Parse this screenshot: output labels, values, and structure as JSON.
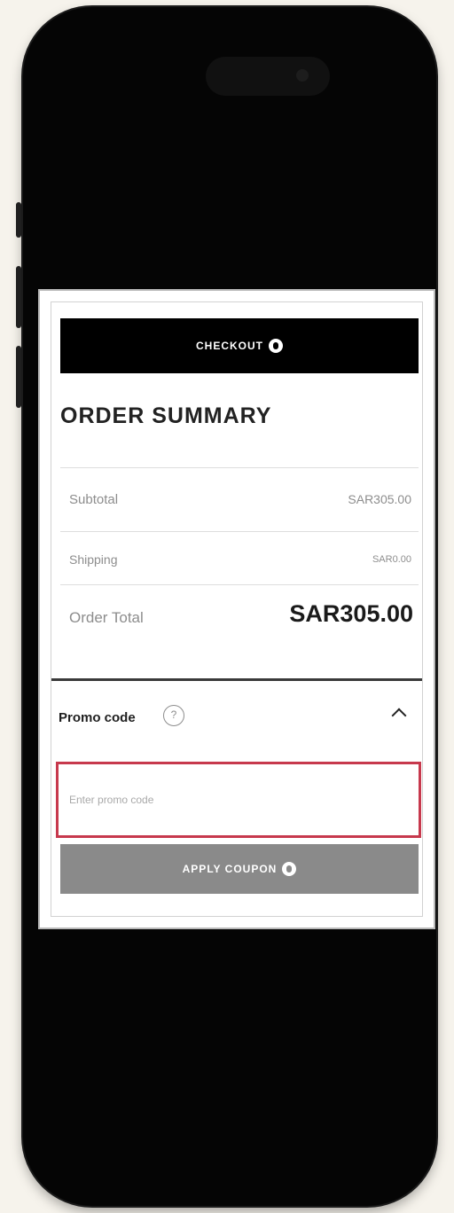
{
  "checkout": {
    "label": "CHECKOUT",
    "icon": "info-circle-icon"
  },
  "summary": {
    "title": "ORDER SUMMARY",
    "rows": [
      {
        "label": "Subtotal",
        "value": "SAR305.00"
      },
      {
        "label": "Shipping",
        "value": "SAR0.00"
      }
    ],
    "total": {
      "label": "Order Total",
      "value": "SAR305.00"
    }
  },
  "promo": {
    "label": "Promo code",
    "info_icon": "?",
    "chevron_icon": "chevron-up-icon",
    "placeholder": "Enter promo code",
    "input_border_color": "#c7394d"
  },
  "apply": {
    "label": "APPLY COUPON",
    "icon": "info-circle-icon"
  },
  "colors": {
    "primary_button": "#000000",
    "disabled_button": "#8a8a8a"
  }
}
